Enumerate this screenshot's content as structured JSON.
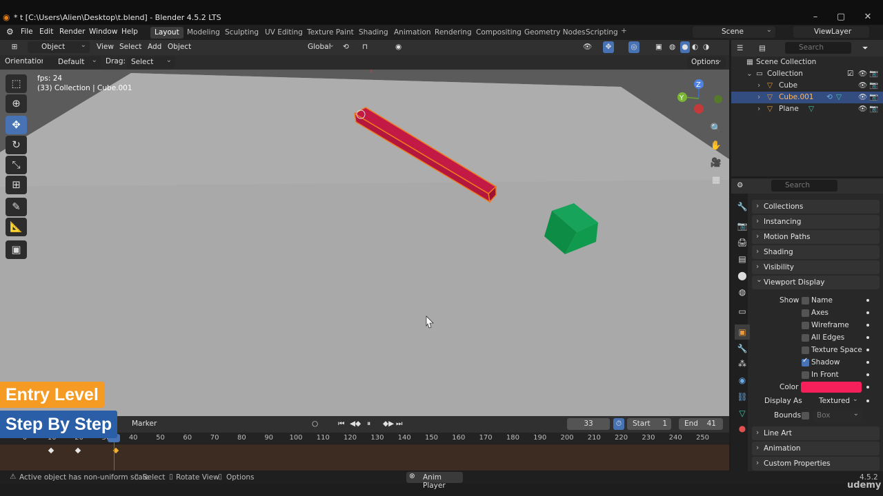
{
  "title": "* t [C:\\Users\\Alien\\Desktop\\t.blend] - Blender 4.5.2 LTS",
  "menu": [
    "File",
    "Edit",
    "Render",
    "Window",
    "Help"
  ],
  "workspaces": [
    "Layout",
    "Modeling",
    "Sculpting",
    "UV Editing",
    "Texture Paint",
    "Shading",
    "Animation",
    "Rendering",
    "Compositing",
    "Geometry Nodes",
    "Scripting"
  ],
  "scene": "Scene",
  "view_layer": "ViewLayer",
  "viewport_header": {
    "mode": "Object Mode",
    "view": "View",
    "select": "Select",
    "add": "Add",
    "object": "Object",
    "transform": "Global"
  },
  "tool_settings": {
    "orientation_label": "Orientation:",
    "orientation": "Default",
    "drag_label": "Drag:",
    "drag": "Select Box",
    "options": "Options"
  },
  "overlay": {
    "fps": "fps: 24",
    "info": "(33) Collection | Cube.001"
  },
  "outliner": {
    "search_placeholder": "Search",
    "scene_collection": "Scene Collection",
    "collection": "Collection",
    "items": [
      {
        "name": "Cube"
      },
      {
        "name": "Cube.001"
      },
      {
        "name": "Plane"
      }
    ]
  },
  "properties": {
    "search_placeholder": "Search",
    "panels_top": [
      "Collections",
      "Instancing",
      "Motion Paths",
      "Shading",
      "Visibility"
    ],
    "viewport_display": "Viewport Display",
    "show_label": "Show",
    "show_items": [
      {
        "label": "Name",
        "on": false
      },
      {
        "label": "Axes",
        "on": false
      },
      {
        "label": "Wireframe",
        "on": false
      },
      {
        "label": "All Edges",
        "on": false
      },
      {
        "label": "Texture Space",
        "on": false
      },
      {
        "label": "Shadow",
        "on": true
      },
      {
        "label": "In Front",
        "on": false
      }
    ],
    "color_label": "Color",
    "color_value": "#f5205a",
    "display_as_label": "Display As",
    "display_as": "Textured",
    "bounds_label": "Bounds",
    "bounds": "Box",
    "panels_bottom": [
      "Line Art",
      "Animation",
      "Custom Properties"
    ]
  },
  "timeline": {
    "marker": "Marker",
    "current_frame": "33",
    "start_label": "Start",
    "start": "1",
    "end_label": "End",
    "end": "41",
    "ticks": [
      "0",
      "10",
      "20",
      "30",
      "40",
      "50",
      "60",
      "70",
      "80",
      "90",
      "100",
      "110",
      "120",
      "130",
      "140",
      "150",
      "160",
      "170",
      "180",
      "190",
      "200",
      "210",
      "220",
      "230",
      "240",
      "250"
    ]
  },
  "status": {
    "message": "Active object has non-uniform scale",
    "select": "Select",
    "rotate": "Rotate View",
    "options": "Options",
    "center": "Anim Player",
    "version": "4.5.2"
  },
  "badges": {
    "line1": "Entry Level",
    "line2": "Step By Step"
  },
  "watermark": "udemy"
}
